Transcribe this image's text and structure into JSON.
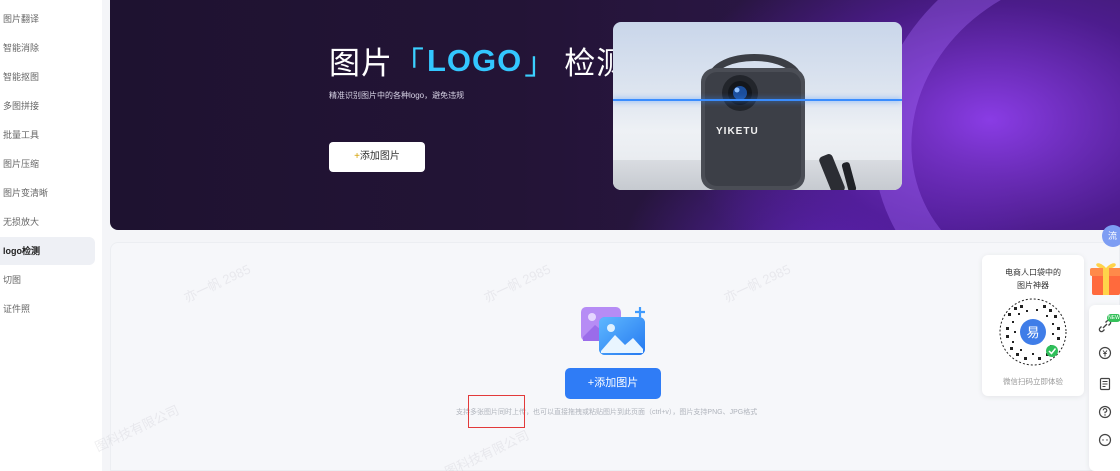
{
  "sidebar": {
    "items": [
      {
        "label": "图片翻译"
      },
      {
        "label": "智能消除"
      },
      {
        "label": "智能抠图"
      },
      {
        "label": "多图拼接"
      },
      {
        "label": "批量工具"
      },
      {
        "label": "图片压缩"
      },
      {
        "label": "图片变清晰"
      },
      {
        "label": "无损放大"
      },
      {
        "label": "logo检测",
        "active": true
      },
      {
        "label": "切图"
      },
      {
        "label": "证件照"
      }
    ]
  },
  "banner": {
    "title_part1": "图片",
    "bracket_open": "「",
    "title_logo": "LOGO",
    "bracket_close": "」",
    "title_part2": "检测",
    "subtitle": "精准识别图片中的各种logo，避免违规",
    "button_plus": "+",
    "button_label": "添加图片",
    "product_brand": "YIKETU"
  },
  "upload": {
    "button_label": "+添加图片",
    "hint": "支持多张图片同时上传，也可以直接拖拽或粘贴图片到此页面（ctrl+v），图片支持PNG、JPG格式",
    "watermarks": [
      "亦一帆 2985",
      "亦一帆 2985",
      "亦一帆 2985",
      "图科技有限公司",
      "图科技有限公司"
    ]
  },
  "qr_card": {
    "title_line1": "电商人口袋中的",
    "title_line2": "图片神器",
    "caption": "微信扫码立即体验",
    "logo_char": "易"
  },
  "right_bar": {
    "new_badge": "NEW",
    "floating_tab_label": "流"
  },
  "colors": {
    "accent": "#2f7cf6",
    "logo_highlight": "#33c7ff",
    "highlight_box": "#e23a3a"
  }
}
